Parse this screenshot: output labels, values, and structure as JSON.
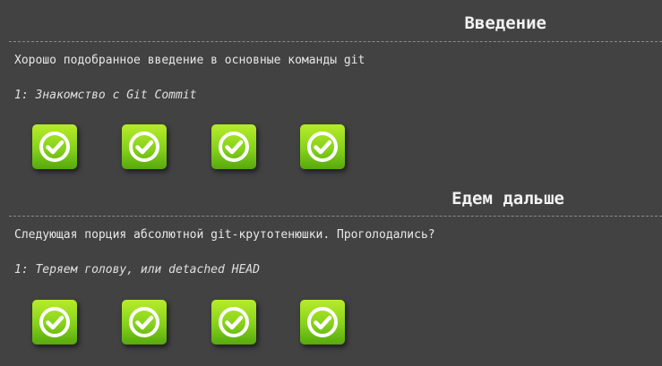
{
  "sections": [
    {
      "title": "Введение",
      "description": "Хорошо подобранное введение в основные команды git",
      "level_name": "1: Знакомство с Git Commit",
      "levels": [
        {
          "icon": "check-icon",
          "completed": true
        },
        {
          "icon": "check-icon",
          "completed": true
        },
        {
          "icon": "check-icon",
          "completed": true
        },
        {
          "icon": "check-icon",
          "completed": true
        }
      ]
    },
    {
      "title": "Едем дальше",
      "description": "Следующая порция абсолютной git-крутотенюшки. Проголодались?",
      "level_name": "1: Теряем голову, или detached HEAD",
      "levels": [
        {
          "icon": "check-icon",
          "completed": true
        },
        {
          "icon": "check-icon",
          "completed": true
        },
        {
          "icon": "check-icon",
          "completed": true
        },
        {
          "icon": "check-icon",
          "completed": true
        }
      ]
    }
  ],
  "colors": {
    "background": "#424242",
    "text": "#eeeeee",
    "level_green_top": "#b7ec2a",
    "level_green_bottom": "#56a90e",
    "check": "#ffffff"
  }
}
